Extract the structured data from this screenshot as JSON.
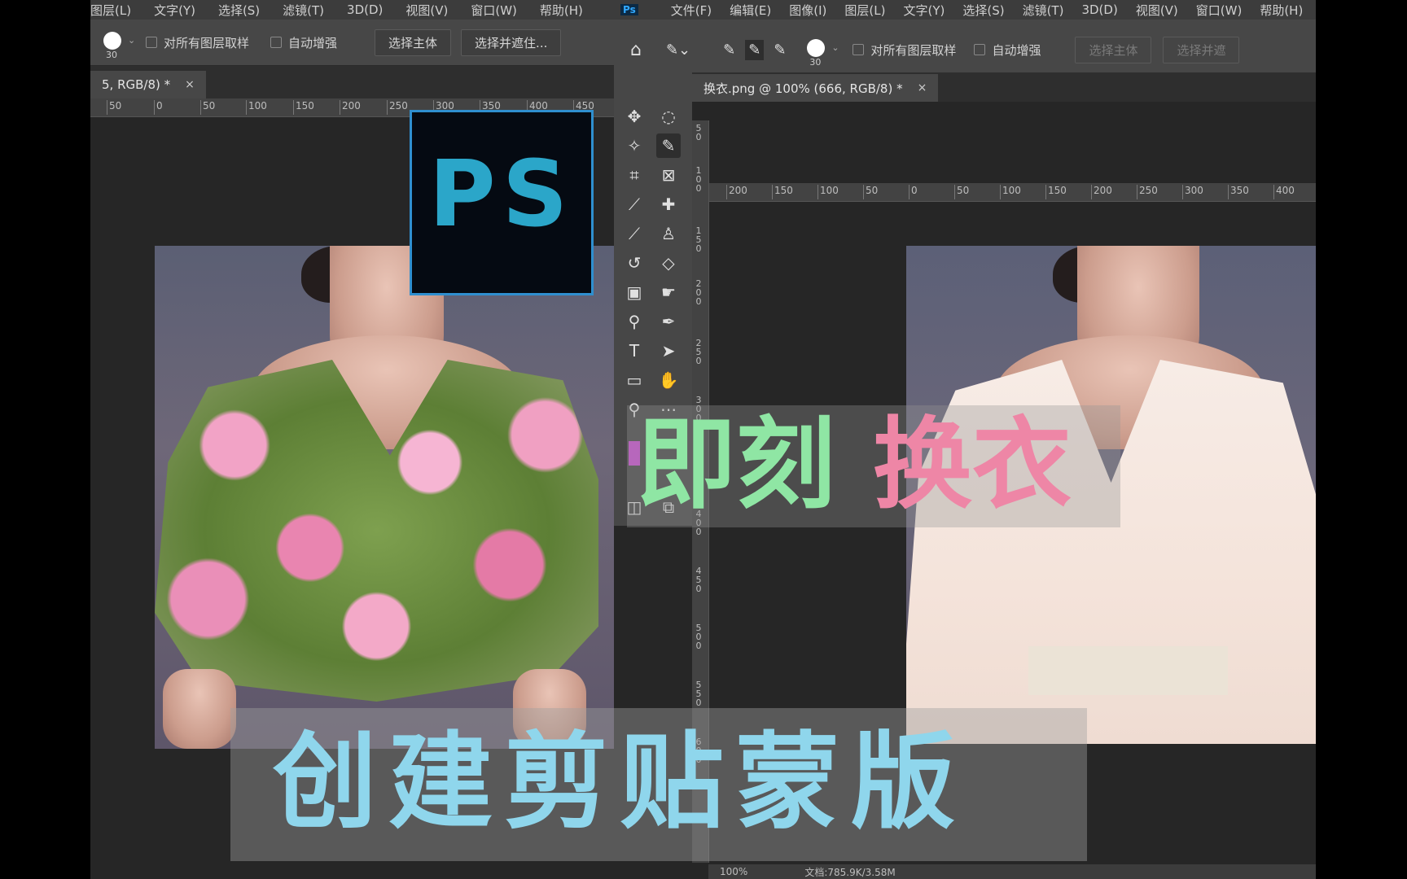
{
  "left_pane": {
    "menu": [
      "图层(L)",
      "文字(Y)",
      "选择(S)",
      "滤镜(T)",
      "3D(D)",
      "视图(V)",
      "窗口(W)",
      "帮助(H)"
    ],
    "brush_size": "30",
    "sample_all_layers": "对所有图层取样",
    "auto_enhance": "自动增强",
    "select_subject": "选择主体",
    "select_mask": "选择并遮住...",
    "tab_title": "5, RGB/8) *",
    "tab_close": "×",
    "ruler_ticks": [
      "50",
      "0",
      "50",
      "100",
      "150",
      "200",
      "250",
      "300",
      "350",
      "400",
      "450"
    ]
  },
  "right_pane": {
    "ps_icon": "Ps",
    "menu": [
      "文件(F)",
      "编辑(E)",
      "图像(I)",
      "图层(L)",
      "文字(Y)",
      "选择(S)",
      "滤镜(T)",
      "3D(D)",
      "视图(V)",
      "窗口(W)",
      "帮助(H)"
    ],
    "brush_size": "30",
    "sample_all_layers": "对所有图层取样",
    "auto_enhance": "自动增强",
    "select_subject": "选择主体",
    "select_mask": "选择并遮",
    "tab_title": "换衣.png @ 100% (666, RGB/8) *",
    "tab_close": "×",
    "ruler_ticks": [
      "200",
      "150",
      "100",
      "50",
      "0",
      "50",
      "100",
      "150",
      "200",
      "250",
      "300",
      "350",
      "400"
    ],
    "vruler_ticks": [
      "50",
      "100",
      "150",
      "200",
      "250",
      "300",
      "350",
      "400",
      "450",
      "500",
      "550",
      "600"
    ],
    "status_zoom": "100%",
    "status_doc": "文档:785.9K/3.58M"
  },
  "logo": {
    "text": "PS",
    "border_color": "#2f8fcf",
    "text_color": "#2ba6c9"
  },
  "captions": {
    "instant_part1": "即刻",
    "instant_part2": "换衣",
    "create_clip_mask": "创建剪贴蒙版"
  },
  "colors": {
    "caption_green": "#8fe6a4",
    "caption_pink": "#ee86a6",
    "caption_blue": "#8fd6ec"
  },
  "tools": [
    "move-icon",
    "marquee-icon",
    "lasso-icon",
    "quick-select-icon",
    "crop-icon",
    "frame-icon",
    "eyedropper-icon",
    "healing-icon",
    "brush-icon",
    "stamp-icon",
    "history-brush-icon",
    "eraser-icon",
    "gradient-icon",
    "smudge-icon",
    "dodge-icon",
    "pen-icon",
    "type-icon",
    "path-select-icon",
    "rectangle-icon",
    "hand-icon",
    "zoom-icon",
    "more-icon",
    "foreground-color-icon",
    "quick-mask-icon",
    "screen-mode-icon"
  ]
}
